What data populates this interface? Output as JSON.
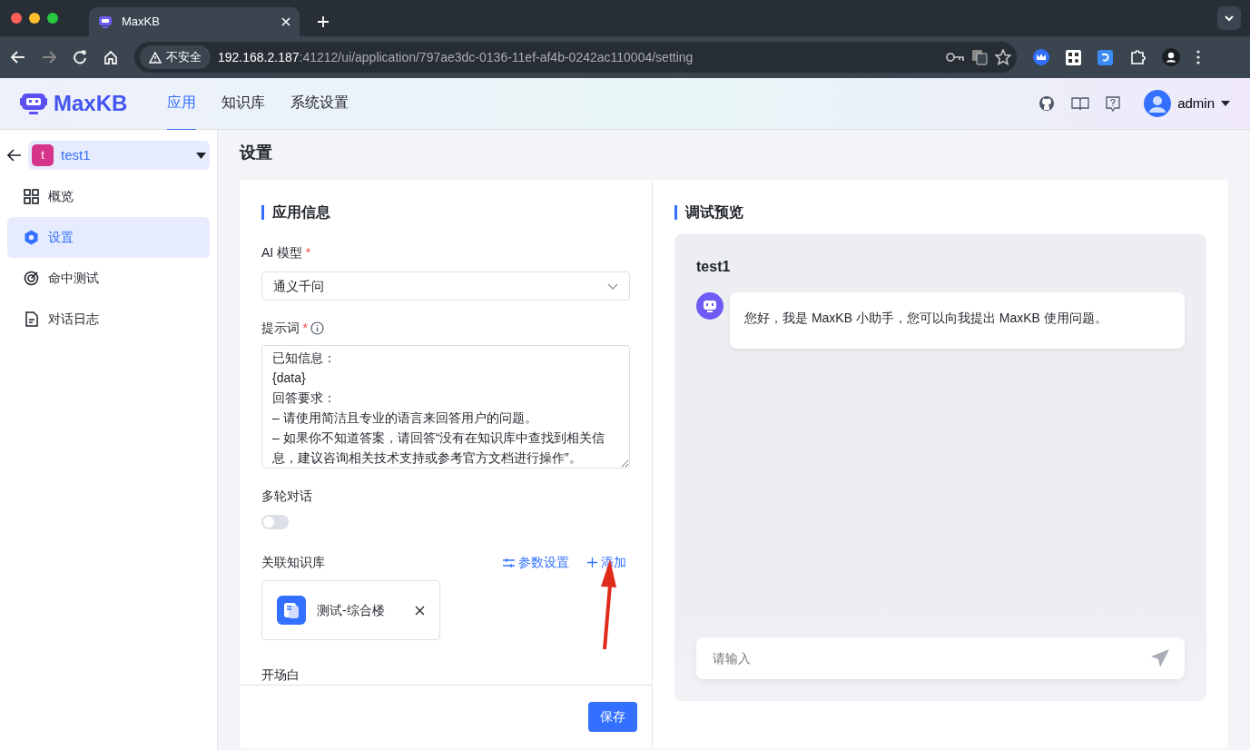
{
  "browser": {
    "tab_title": "MaxKB",
    "security_label": "不安全",
    "url_host": "192.168.2.187",
    "url_rest": ":41212/ui/application/797ae3dc-0136-11ef-af4b-0242ac110004/setting"
  },
  "header": {
    "logo": "MaxKB",
    "nav": [
      {
        "label": "应用",
        "selected": true
      },
      {
        "label": "知识库",
        "selected": false
      },
      {
        "label": "系统设置",
        "selected": false
      }
    ],
    "user": "admin"
  },
  "sidebar": {
    "app_letter": "t",
    "app_name": "test1",
    "items": [
      {
        "kind": "grid",
        "label": "概览",
        "selected": false
      },
      {
        "kind": "gear",
        "label": "设置",
        "selected": true
      },
      {
        "kind": "target",
        "label": "命中测试",
        "selected": false
      },
      {
        "kind": "doc",
        "label": "对话日志",
        "selected": false
      }
    ]
  },
  "page_title": "设置",
  "settings": {
    "section_title": "应用信息",
    "model_label": "AI 模型",
    "model_required": "*",
    "model_value": "通义千问",
    "prompt_label": "提示词",
    "prompt_required": "*",
    "prompt_lines": [
      "已知信息：",
      "{data}",
      "回答要求：",
      "– 请使用简洁且专业的语言来回答用户的问题。",
      "– 如果你不知道答案，请回答“没有在知识库中查找到相关信",
      "息，建议咨询相关技术支持或参考官方文档进行操作”。"
    ],
    "multi_turn": {
      "label": "多轮对话",
      "on": false
    },
    "kb_label": "关联知识库",
    "param_link": "参数设置",
    "add_link": "添加",
    "datasets": [
      {
        "name": "测试-综合楼"
      }
    ],
    "opening_label": "开场白",
    "save_button": "保存"
  },
  "preview": {
    "section_title": "调试预览",
    "app_name": "test1",
    "greeting": "您好，我是 MaxKB 小助手，您可以向我提出 MaxKB 使用问题。",
    "input": {
      "placeholder": "请输入"
    }
  }
}
